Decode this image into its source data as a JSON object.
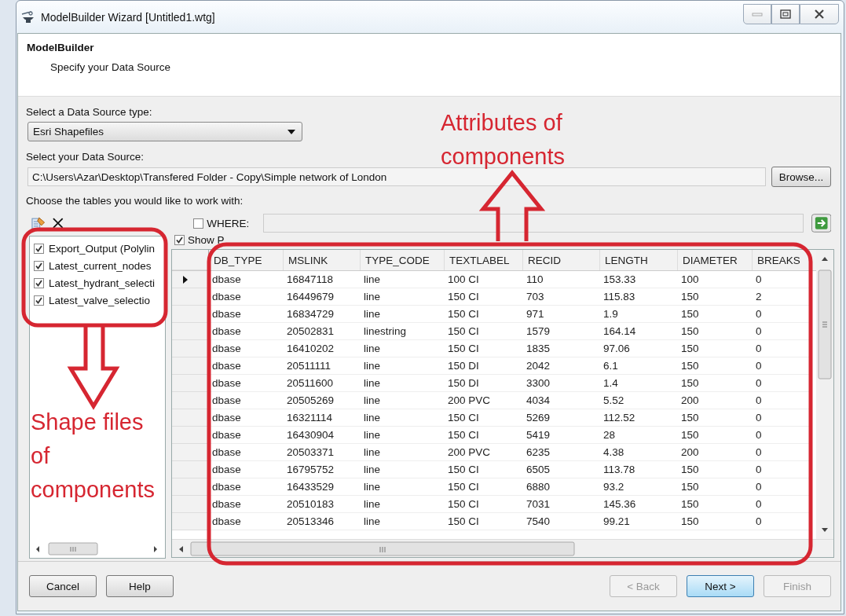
{
  "window": {
    "title": "ModelBuilder Wizard [Untitled1.wtg]"
  },
  "header": {
    "title": "ModelBuilder",
    "subtitle": "Specify your Data Source"
  },
  "source_type": {
    "label": "Select a Data Source type:",
    "value": "Esri Shapefiles"
  },
  "data_source": {
    "label": "Select your Data Source:",
    "value": "C:\\Users\\Azar\\Desktop\\Transfered Folder - Copy\\Simple network of London",
    "button": "Browse..."
  },
  "tables_label": "Choose the tables you would like to work with:",
  "where": {
    "label": "WHERE:",
    "checked": false
  },
  "show_preview": {
    "label": "Show P",
    "checked": true
  },
  "tables": [
    {
      "label": "Export_Output (Polylin",
      "checked": true
    },
    {
      "label": "Latest_current_nodes",
      "checked": true
    },
    {
      "label": "Latest_hydrant_selecti",
      "checked": true
    },
    {
      "label": "Latest_valve_selectio",
      "checked": true
    }
  ],
  "grid": {
    "columns": [
      "DB_TYPE",
      "MSLINK",
      "TYPE_CODE",
      "TEXTLABEL",
      "RECID",
      "LENGTH",
      "DIAMETER",
      "BREAKS"
    ],
    "rows": [
      {
        "current": true,
        "cells": [
          "dbase",
          "16847118",
          "line",
          "100 CI",
          "110",
          "153.33",
          "100",
          "0"
        ]
      },
      {
        "current": false,
        "cells": [
          "dbase",
          "16449679",
          "line",
          "150 CI",
          "703",
          "115.83",
          "150",
          "2"
        ]
      },
      {
        "current": false,
        "cells": [
          "dbase",
          "16834729",
          "line",
          "150 CI",
          "971",
          "1.9",
          "150",
          "0"
        ]
      },
      {
        "current": false,
        "cells": [
          "dbase",
          "20502831",
          "linestring",
          "150 CI",
          "1579",
          "164.14",
          "150",
          "0"
        ]
      },
      {
        "current": false,
        "cells": [
          "dbase",
          "16410202",
          "line",
          "150 CI",
          "1835",
          "97.06",
          "150",
          "0"
        ]
      },
      {
        "current": false,
        "cells": [
          "dbase",
          "20511111",
          "line",
          "150 DI",
          "2042",
          "6.1",
          "150",
          "0"
        ]
      },
      {
        "current": false,
        "cells": [
          "dbase",
          "20511600",
          "line",
          "150 DI",
          "3300",
          "1.4",
          "150",
          "0"
        ]
      },
      {
        "current": false,
        "cells": [
          "dbase",
          "20505269",
          "line",
          "200 PVC",
          "4034",
          "5.52",
          "200",
          "0"
        ]
      },
      {
        "current": false,
        "cells": [
          "dbase",
          "16321114",
          "line",
          "150 CI",
          "5269",
          "112.52",
          "150",
          "0"
        ]
      },
      {
        "current": false,
        "cells": [
          "dbase",
          "16430904",
          "line",
          "150 CI",
          "5419",
          "28",
          "150",
          "0"
        ]
      },
      {
        "current": false,
        "cells": [
          "dbase",
          "20503371",
          "line",
          "200 PVC",
          "6235",
          "4.38",
          "200",
          "0"
        ]
      },
      {
        "current": false,
        "cells": [
          "dbase",
          "16795752",
          "line",
          "150 CI",
          "6505",
          "113.78",
          "150",
          "0"
        ]
      },
      {
        "current": false,
        "cells": [
          "dbase",
          "16433529",
          "line",
          "150 CI",
          "6880",
          "93.2",
          "150",
          "0"
        ]
      },
      {
        "current": false,
        "cells": [
          "dbase",
          "20510183",
          "line",
          "150 CI",
          "7031",
          "145.36",
          "150",
          "0"
        ]
      },
      {
        "current": false,
        "cells": [
          "dbase",
          "20513346",
          "line",
          "150 CI",
          "7540",
          "99.21",
          "150",
          "0"
        ]
      }
    ]
  },
  "buttons": [
    {
      "label": "Cancel",
      "disabled": false,
      "default": false
    },
    {
      "label": "Help",
      "disabled": false,
      "default": false
    },
    {
      "label": "< Back",
      "disabled": true,
      "default": false
    },
    {
      "label": "Next >",
      "disabled": false,
      "default": true
    },
    {
      "label": "Finish",
      "disabled": true,
      "default": false
    }
  ],
  "annotations": [
    {
      "kind": "up",
      "text": "Attributes of components"
    },
    {
      "kind": "down",
      "text": "Shape files of components"
    }
  ]
}
